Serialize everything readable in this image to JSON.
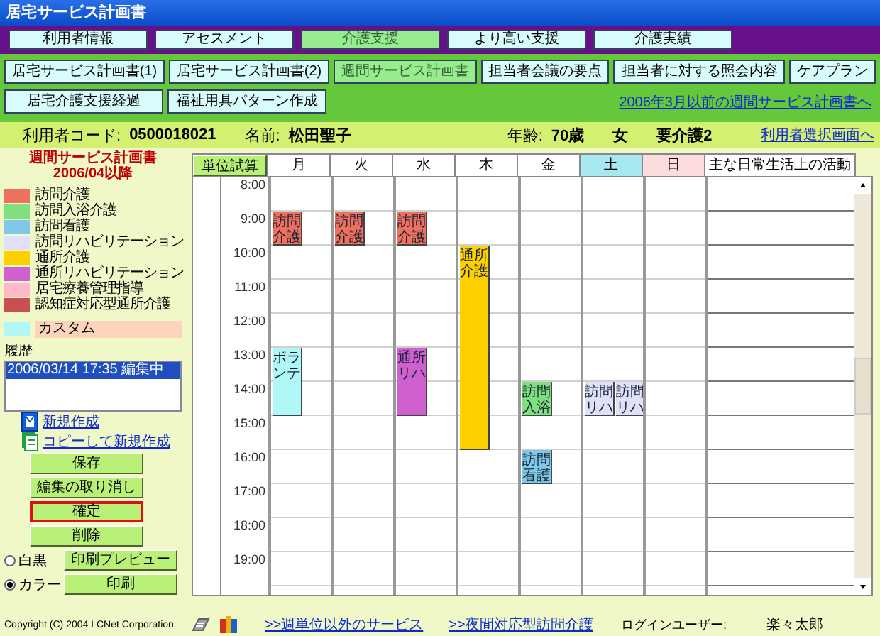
{
  "window": {
    "title": "居宅サービス計画書"
  },
  "main_tabs": [
    {
      "label": "利用者情報",
      "selected": false
    },
    {
      "label": "アセスメント",
      "selected": false
    },
    {
      "label": "介護支援",
      "selected": true
    },
    {
      "label": "より高い支援",
      "selected": false
    },
    {
      "label": "介護実績",
      "selected": false
    }
  ],
  "sub_tabs": [
    {
      "label": "居宅サービス計画書(1)",
      "selected": false
    },
    {
      "label": "居宅サービス計画書(2)",
      "selected": false
    },
    {
      "label": "週間サービス計画書",
      "selected": true
    },
    {
      "label": "担当者会議の要点",
      "selected": false
    },
    {
      "label": "担当者に対する照会内容",
      "selected": false
    },
    {
      "label": "ケアプラン",
      "selected": false
    },
    {
      "label": "居宅介護支援経過",
      "selected": false
    },
    {
      "label": "福祉用具パターン作成",
      "selected": false
    }
  ],
  "old_plan_link": "2006年3月以前の週間サービス計画書へ",
  "user_info": {
    "code_label": "利用者コード:",
    "code": "0500018021",
    "name_label": "名前:",
    "name": "松田聖子",
    "age_label": "年齢:",
    "age": "70歳",
    "sex": "女",
    "care_level": "要介護2",
    "select_link": "利用者選択画面へ"
  },
  "sidebar": {
    "title": "週間サービス計画書",
    "period": "2006/04以降",
    "legend": [
      {
        "label": "訪問介護",
        "color": "#f07060"
      },
      {
        "label": "訪問入浴介護",
        "color": "#80e080"
      },
      {
        "label": "訪問看護",
        "color": "#80c8e8"
      },
      {
        "label": "訪問リハビリテーション",
        "color": "#e0e0f8"
      },
      {
        "label": "通所介護",
        "color": "#ffd000"
      },
      {
        "label": "通所リハビリテーション",
        "color": "#d060d0"
      },
      {
        "label": "居宅療養管理指導",
        "color": "#ffb8c8"
      },
      {
        "label": "認知症対応型通所介護",
        "color": "#c85050"
      }
    ],
    "custom": {
      "label": "カスタム",
      "color": "#b0f8f8"
    },
    "history_label": "履歴",
    "history": [
      {
        "text": "2006/03/14 17:35 編集中",
        "selected": true
      }
    ],
    "links": [
      {
        "label": "新規作成",
        "kind": "new"
      },
      {
        "label": "コピーして新規作成",
        "kind": "copy"
      }
    ],
    "actions": [
      {
        "label": "保存",
        "focused": false
      },
      {
        "label": "編集の取り消し",
        "focused": false
      },
      {
        "label": "確定",
        "focused": true
      },
      {
        "label": "削除",
        "focused": false
      }
    ],
    "print_modes": [
      {
        "label": "白黒",
        "selected": false
      },
      {
        "label": "カラー",
        "selected": true
      }
    ],
    "print_buttons": [
      "印刷プレビュー",
      "印刷"
    ]
  },
  "schedule": {
    "calc_button": "単位試算",
    "activity_header": "主な日常生活上の活動",
    "days": [
      {
        "label": "月",
        "kind": "weekday"
      },
      {
        "label": "火",
        "kind": "weekday"
      },
      {
        "label": "水",
        "kind": "weekday"
      },
      {
        "label": "木",
        "kind": "weekday"
      },
      {
        "label": "金",
        "kind": "weekday"
      },
      {
        "label": "土",
        "kind": "saturday"
      },
      {
        "label": "日",
        "kind": "sunday"
      }
    ],
    "rows": [
      {
        "time": "8:00",
        "cells": [
          {},
          {},
          {},
          {},
          {},
          {},
          {}
        ]
      },
      {
        "time": "9:00",
        "cells": [
          {
            "blocks": [
              {
                "label": "訪問介護",
                "color": "#f07060"
              }
            ]
          },
          {
            "blocks": [
              {
                "label": "訪問介護",
                "color": "#f07060"
              }
            ]
          },
          {
            "blocks": [
              {
                "label": "訪問介護",
                "color": "#f07060"
              }
            ]
          },
          {},
          {},
          {},
          {}
        ]
      },
      {
        "time": "10:00",
        "cells": [
          {},
          {},
          {},
          {
            "blocks": [
              {
                "label": "通所介護",
                "color": "#ffd000"
              }
            ]
          },
          {},
          {},
          {}
        ]
      },
      {
        "time": "11:00",
        "cells": [
          {},
          {},
          {},
          {
            "blocks": [
              {
                "color": "#ffd000"
              }
            ]
          },
          {},
          {},
          {}
        ]
      },
      {
        "time": "12:00",
        "cells": [
          {},
          {},
          {},
          {
            "blocks": [
              {
                "color": "#ffd000"
              }
            ]
          },
          {},
          {},
          {}
        ]
      },
      {
        "time": "13:00",
        "cells": [
          {
            "blocks": [
              {
                "label": "ボランテ",
                "color": "#b0f8f8"
              }
            ]
          },
          {},
          {
            "blocks": [
              {
                "label": "通所リハ",
                "color": "#d060d0"
              }
            ]
          },
          {
            "blocks": [
              {
                "color": "#ffd000"
              }
            ]
          },
          {},
          {},
          {}
        ]
      },
      {
        "time": "14:00",
        "cells": [
          {
            "blocks": [
              {
                "color": "#b0f8f8"
              }
            ]
          },
          {},
          {
            "blocks": [
              {
                "color": "#d060d0"
              }
            ]
          },
          {
            "blocks": [
              {
                "color": "#ffd000"
              }
            ]
          },
          {
            "blocks": [
              {
                "label": "訪問入浴",
                "color": "#80e080"
              }
            ]
          },
          {
            "blocks": [
              {
                "label": "訪問リハ",
                "color": "#e0e0f8"
              },
              {
                "label": "訪問リハ",
                "color": "#e0e0f8"
              }
            ]
          },
          {}
        ]
      },
      {
        "time": "15:00",
        "cells": [
          {},
          {},
          {},
          {
            "blocks": [
              {
                "color": "#ffd000"
              }
            ]
          },
          {},
          {},
          {}
        ]
      },
      {
        "time": "16:00",
        "cells": [
          {},
          {},
          {},
          {},
          {
            "blocks": [
              {
                "label": "訪問看護",
                "color": "#80c8e8"
              }
            ]
          },
          {},
          {}
        ]
      },
      {
        "time": "17:00",
        "cells": [
          {},
          {},
          {},
          {},
          {},
          {},
          {}
        ]
      },
      {
        "time": "18:00",
        "cells": [
          {},
          {},
          {},
          {},
          {},
          {},
          {}
        ]
      },
      {
        "time": "19:00",
        "cells": [
          {},
          {},
          {},
          {},
          {},
          {},
          {}
        ]
      }
    ]
  },
  "footer": {
    "copyright": "Copyright (C) 2004 LCNet Corporation",
    "links": [
      ">>週単位以外のサービス",
      ">>夜間対応型訪問介護"
    ],
    "login_label": "ログインユーザー:",
    "login_user": "楽々太郎"
  }
}
